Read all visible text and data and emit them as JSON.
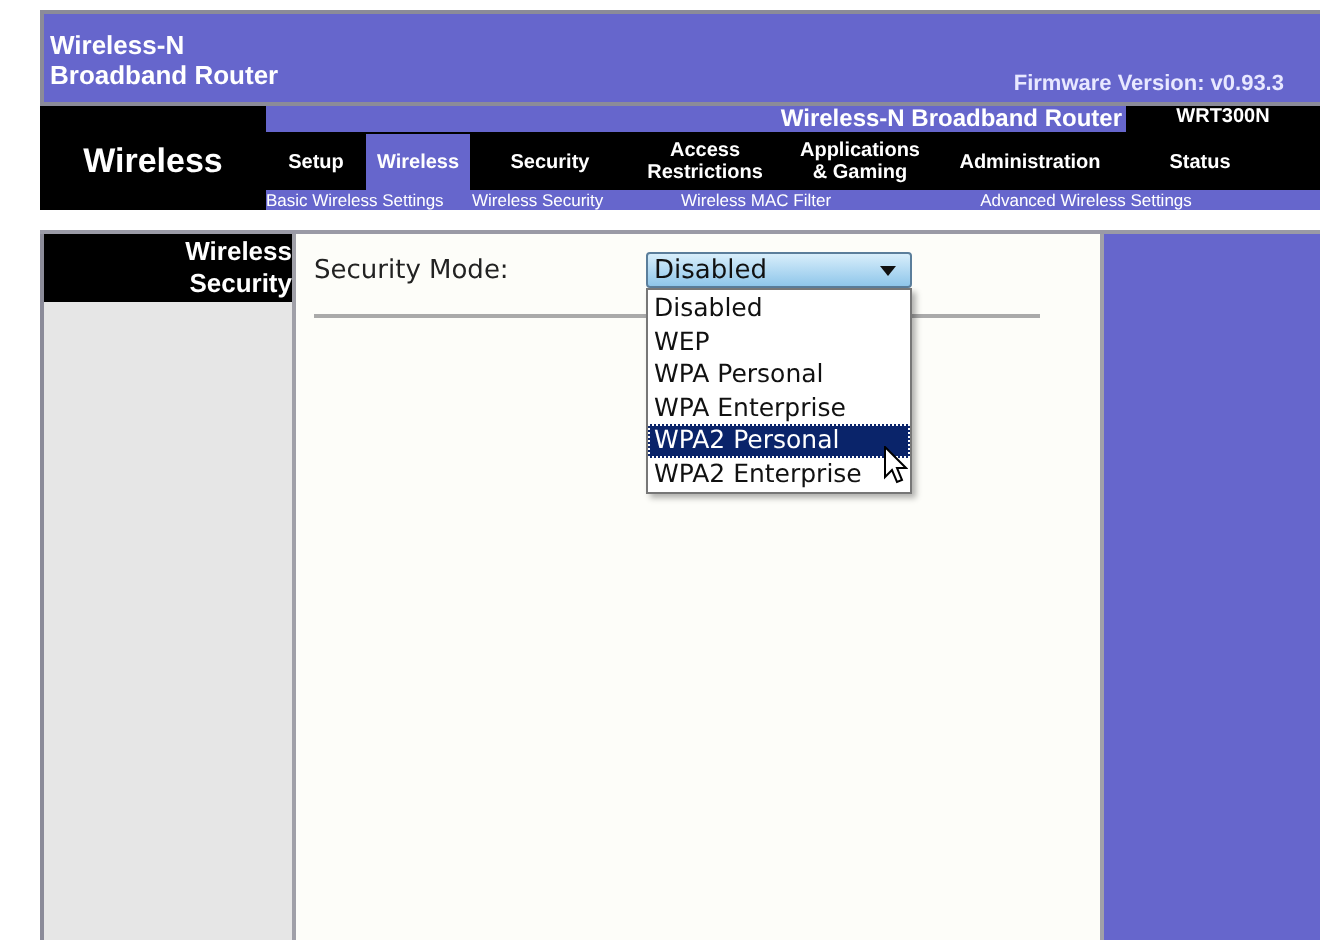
{
  "header": {
    "product": "Wireless-N",
    "product_line2": "Broadband Router",
    "firmware": "Firmware Version: v0.93.3"
  },
  "nav": {
    "section": "Wireless",
    "banner": "Wireless-N Broadband Router",
    "model": "WRT300N",
    "tabs": [
      {
        "label": "Setup",
        "selected": false
      },
      {
        "label": "Wireless",
        "selected": true
      },
      {
        "label": "Security",
        "selected": false
      },
      {
        "label": "Access Restrictions",
        "selected": false
      },
      {
        "label": "Applications & Gaming",
        "selected": false
      },
      {
        "label": "Administration",
        "selected": false
      },
      {
        "label": "Status",
        "selected": false
      }
    ],
    "subtabs": [
      "Basic Wireless Settings",
      "Wireless Security",
      "Wireless MAC Filter",
      "Advanced Wireless Settings"
    ]
  },
  "sidebar": {
    "title": "Wireless Security"
  },
  "form": {
    "label": "Security Mode:",
    "value": "Disabled",
    "expanded": true,
    "options": [
      {
        "label": "Disabled",
        "highlighted": false
      },
      {
        "label": "WEP",
        "highlighted": false
      },
      {
        "label": "WPA Personal",
        "highlighted": false
      },
      {
        "label": "WPA Enterprise",
        "highlighted": false
      },
      {
        "label": "WPA2 Personal",
        "highlighted": true
      },
      {
        "label": "WPA2 Enterprise",
        "highlighted": false
      }
    ]
  }
}
